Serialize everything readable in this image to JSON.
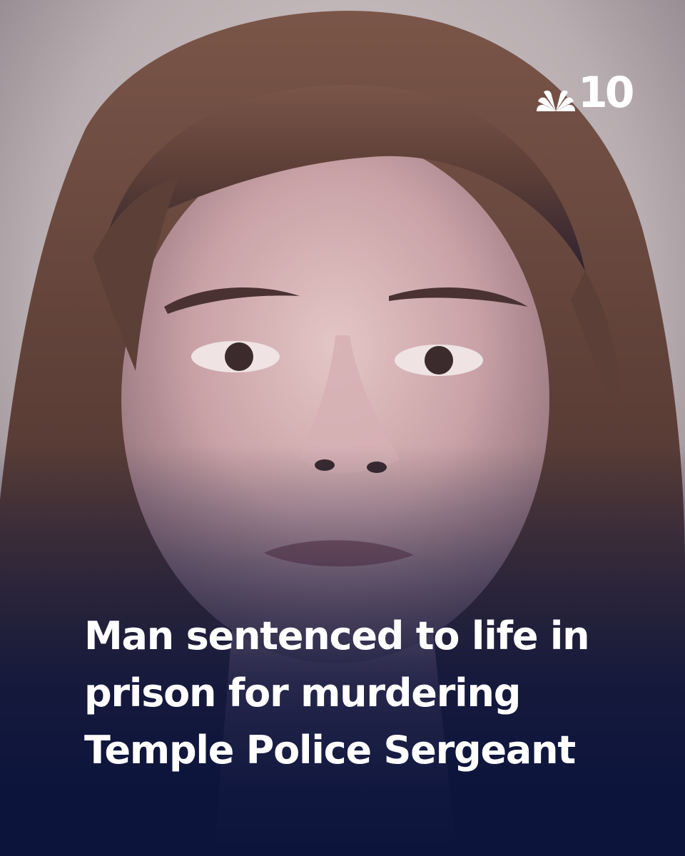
{
  "brand": {
    "logo_number": "10",
    "logo_icon": "peacock-icon"
  },
  "headline": {
    "lines": [
      "Man sentenced to life in",
      "prison for murdering",
      "Temple Police Sergeant"
    ]
  },
  "colors": {
    "overlay_navy": "#0c143c",
    "text": "#ffffff"
  }
}
